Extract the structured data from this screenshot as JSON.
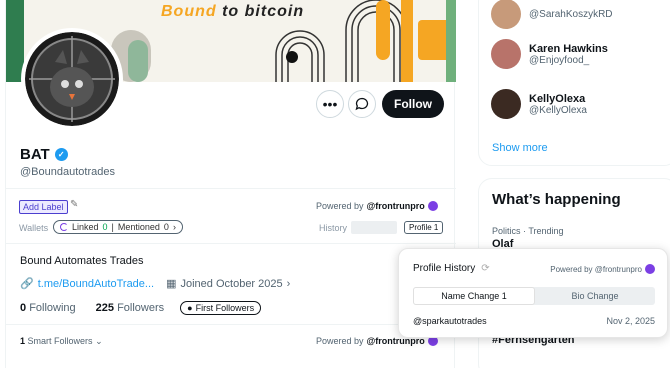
{
  "banner": {
    "text_highlight": "Bound",
    "text_rest": " to bitcoin"
  },
  "profile": {
    "name": "BAT",
    "handle": "@Boundautotrades",
    "bio": "Bound Automates Trades",
    "link": "t.me/BoundAutoTrade...",
    "joined": "Joined October 2025",
    "following_count": "0",
    "following_label": "Following",
    "followers_count": "225",
    "followers_label": "Followers",
    "first_followers_label": "First Followers"
  },
  "actions": {
    "more_icon": "more-icon",
    "dm_icon": "message-icon",
    "follow_label": "Follow"
  },
  "frontrun": {
    "add_label": "Add Label",
    "powered_prefix": "Powered by ",
    "powered_brand": "@frontrunpro",
    "wallets_label": "Wallets",
    "linked_label": "Linked",
    "linked_count": "0",
    "mentioned_label": "Mentioned",
    "mentioned_count": "0",
    "history_label": "History",
    "profile_tag": "Profile 1",
    "smart_followers_count": "1",
    "smart_followers_label": "Smart Followers"
  },
  "who_to_follow": [
    {
      "name": "",
      "handle": "@SarahKoszykRD"
    },
    {
      "name": "Karen Hawkins",
      "handle": "@Enjoyfood_"
    },
    {
      "name": "KellyOlexa",
      "handle": "@KellyOlexa"
    }
  ],
  "show_more": "Show more",
  "trends": {
    "title": "What’s happening",
    "category": "Politics · Trending",
    "name": "Olaf",
    "name2": "#Fernsehgarten"
  },
  "popup": {
    "title": "Profile History",
    "powered": "Powered by @frontrunpro",
    "tab_active": "Name Change 1",
    "tab_other": "Bio Change",
    "entry_handle": "@sparkautotrades",
    "entry_date": "Nov 2, 2025"
  },
  "colors": {
    "accent": "#1d9bf0",
    "frontrun": "#7b3fe4",
    "follow_bg": "#0f1419"
  }
}
